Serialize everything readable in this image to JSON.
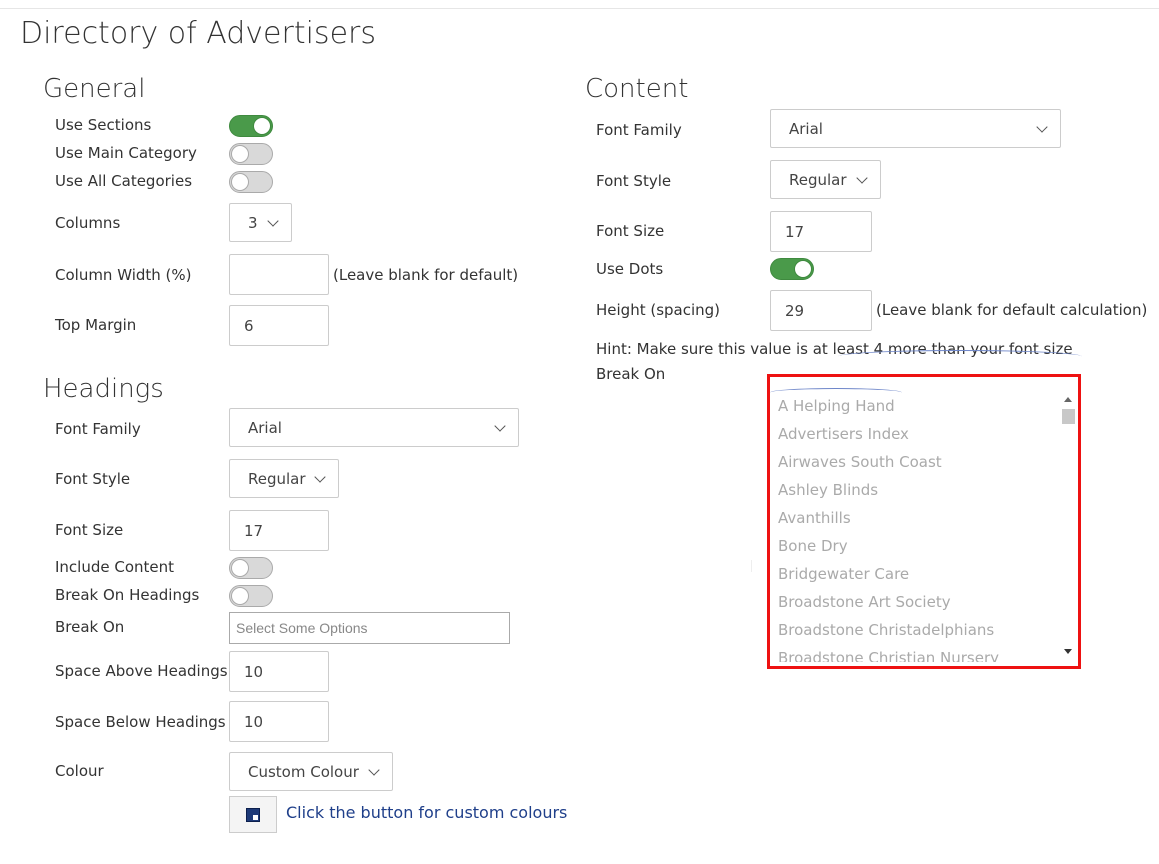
{
  "page": {
    "title": "Directory of Advertisers"
  },
  "general": {
    "title": "General",
    "use_sections": {
      "label": "Use Sections",
      "on": true
    },
    "use_main_category": {
      "label": "Use Main Category",
      "on": false
    },
    "use_all_categories": {
      "label": "Use All Categories",
      "on": false
    },
    "columns": {
      "label": "Columns",
      "value": "3"
    },
    "column_width": {
      "label": "Column Width (%)",
      "value": "",
      "note": "(Leave blank for default)"
    },
    "top_margin": {
      "label": "Top Margin",
      "value": "6"
    }
  },
  "headings": {
    "title": "Headings",
    "font_family": {
      "label": "Font Family",
      "value": "Arial"
    },
    "font_style": {
      "label": "Font Style",
      "value": "Regular"
    },
    "font_size": {
      "label": "Font Size",
      "value": "17"
    },
    "include_content": {
      "label": "Include Content",
      "on": false
    },
    "break_on_headings": {
      "label": "Break On Headings",
      "on": false
    },
    "break_on": {
      "label": "Break On",
      "placeholder": "Select Some Options"
    },
    "space_above": {
      "label": "Space Above Headings",
      "value": "10"
    },
    "space_below": {
      "label": "Space Below Headings",
      "value": "10"
    },
    "colour": {
      "label": "Colour",
      "value": "Custom Colour"
    },
    "colour_button": {
      "link_text": "Click the button for custom colours"
    }
  },
  "content": {
    "title": "Content",
    "font_family": {
      "label": "Font Family",
      "value": "Arial"
    },
    "font_style": {
      "label": "Font Style",
      "value": "Regular"
    },
    "font_size": {
      "label": "Font Size",
      "value": "17"
    },
    "use_dots": {
      "label": "Use Dots",
      "on": true
    },
    "height": {
      "label": "Height (spacing)",
      "value": "29",
      "note": "(Leave blank for default calculation)"
    },
    "hint": "Hint: Make sure this value is at least 4 more than your font size",
    "break_on": {
      "label": "Break On"
    },
    "options": [
      "A Helping Hand",
      "Advertisers Index",
      "Airwaves South Coast",
      "Ashley Blinds",
      "Avanthills",
      "Bone Dry",
      "Bridgewater Care",
      "Broadstone Art Society",
      "Broadstone Christadelphians",
      "Broadstone Christian Nursery"
    ]
  },
  "colors": {
    "toggle_on": "#4a9a4a",
    "highlight": "#e11111",
    "link": "#1f3f8a"
  }
}
